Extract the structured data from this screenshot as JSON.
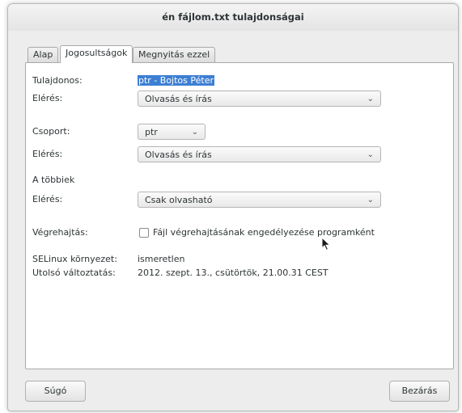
{
  "window": {
    "title": "én fájlom.txt tulajdonságai"
  },
  "tabs": [
    {
      "label": "Alap"
    },
    {
      "label": "Jogosultságok"
    },
    {
      "label": "Megnyitás ezzel"
    }
  ],
  "owner": {
    "label": "Tulajdonos:",
    "value": "ptr - Bojtos Péter"
  },
  "owner_access": {
    "label": "Elérés:",
    "value": "Olvasás és írás"
  },
  "group": {
    "label": "Csoport:",
    "value": "ptr"
  },
  "group_access": {
    "label": "Elérés:",
    "value": "Olvasás és írás"
  },
  "others": {
    "heading": "A többiek"
  },
  "others_access": {
    "label": "Elérés:",
    "value": "Csak olvasható"
  },
  "execute": {
    "label": "Végrehajtás:",
    "checkbox_label": "Fájl végrehajtásának engedélyezése programként",
    "checked": false
  },
  "selinux": {
    "label": "SELinux környezet:",
    "value": "ismeretlen"
  },
  "modified": {
    "label": "Utolsó változtatás:",
    "value": "2012. szept. 13., csütörtök, 21.00.31 CEST"
  },
  "buttons": {
    "help": "Súgó",
    "close": "Bezárás"
  },
  "icons": {
    "dropdown": "chevron-down-icon",
    "cursor": "mouse-pointer-icon"
  },
  "colors": {
    "selection": "#3d7fd4"
  }
}
